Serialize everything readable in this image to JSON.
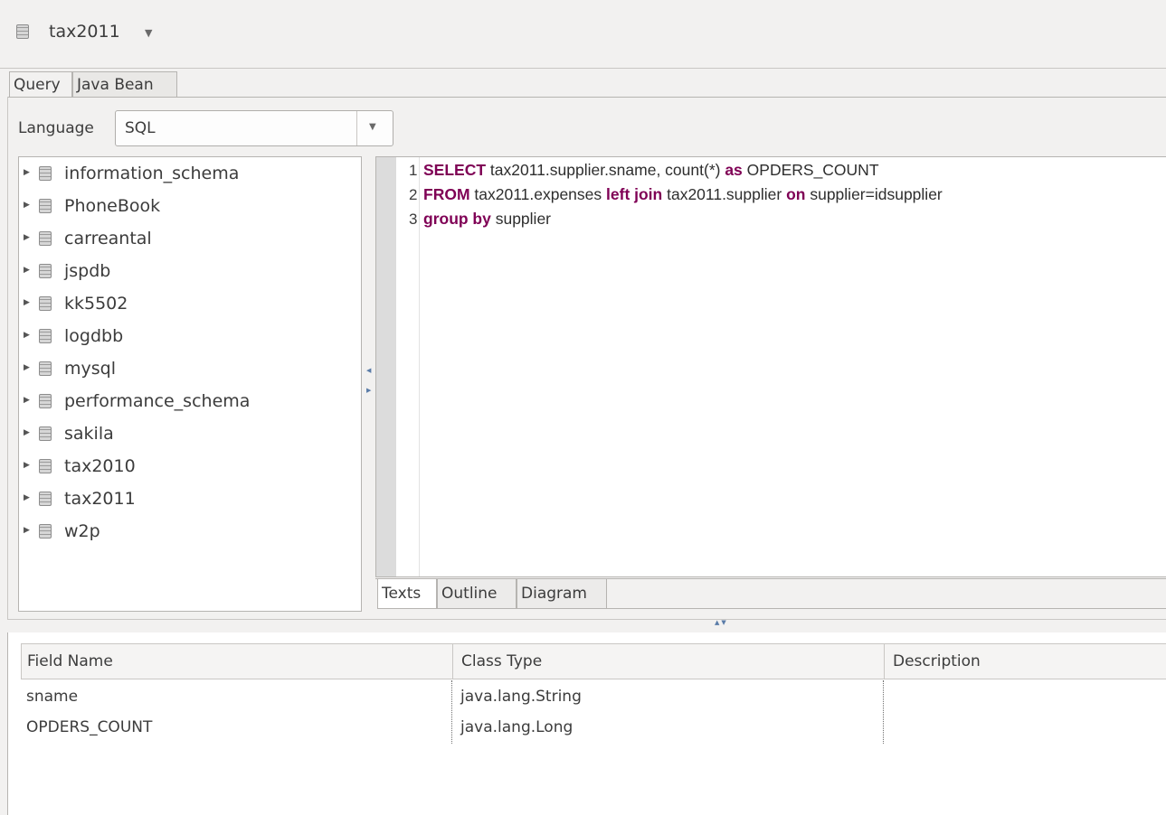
{
  "header": {
    "title": "tax2011",
    "icon": "database-icon"
  },
  "tabs": [
    {
      "label": "Query",
      "active": true
    },
    {
      "label": "Java Bean",
      "active": false
    }
  ],
  "language": {
    "label": "Language",
    "value": "SQL"
  },
  "tree": {
    "items": [
      {
        "label": "information_schema"
      },
      {
        "label": "PhoneBook"
      },
      {
        "label": "carreantal"
      },
      {
        "label": "jspdb"
      },
      {
        "label": "kk5502"
      },
      {
        "label": "logdbb"
      },
      {
        "label": "mysql"
      },
      {
        "label": "performance_schema"
      },
      {
        "label": "sakila"
      },
      {
        "label": "tax2010"
      },
      {
        "label": "tax2011"
      },
      {
        "label": "w2p"
      }
    ]
  },
  "editor": {
    "lines": [
      {
        "num": "1",
        "tokens": [
          {
            "text": "SELECT",
            "kw": true
          },
          {
            "text": " tax2011.supplier.sname, count(*) ",
            "kw": false
          },
          {
            "text": "as",
            "kw": true
          },
          {
            "text": " OPDERS_COUNT",
            "kw": false
          }
        ]
      },
      {
        "num": "2",
        "tokens": [
          {
            "text": "FROM",
            "kw": true
          },
          {
            "text": " tax2011.expenses ",
            "kw": false
          },
          {
            "text": "left join",
            "kw": true
          },
          {
            "text": " tax2011.supplier ",
            "kw": false
          },
          {
            "text": "on",
            "kw": true
          },
          {
            "text": " supplier=idsupplier",
            "kw": false
          }
        ]
      },
      {
        "num": "3",
        "tokens": [
          {
            "text": "group by",
            "kw": true
          },
          {
            "text": " supplier",
            "kw": false
          }
        ]
      }
    ],
    "tabs": [
      {
        "label": "Texts",
        "active": true
      },
      {
        "label": "Outline",
        "active": false
      },
      {
        "label": "Diagram",
        "active": false
      }
    ],
    "keyword_color": "#7f0055"
  },
  "fields_table": {
    "columns": [
      "Field Name",
      "Class Type",
      "Description"
    ],
    "rows": [
      {
        "field": "sname",
        "class": "java.lang.String",
        "description": ""
      },
      {
        "field": "OPDERS_COUNT",
        "class": "java.lang.Long",
        "description": ""
      }
    ]
  }
}
